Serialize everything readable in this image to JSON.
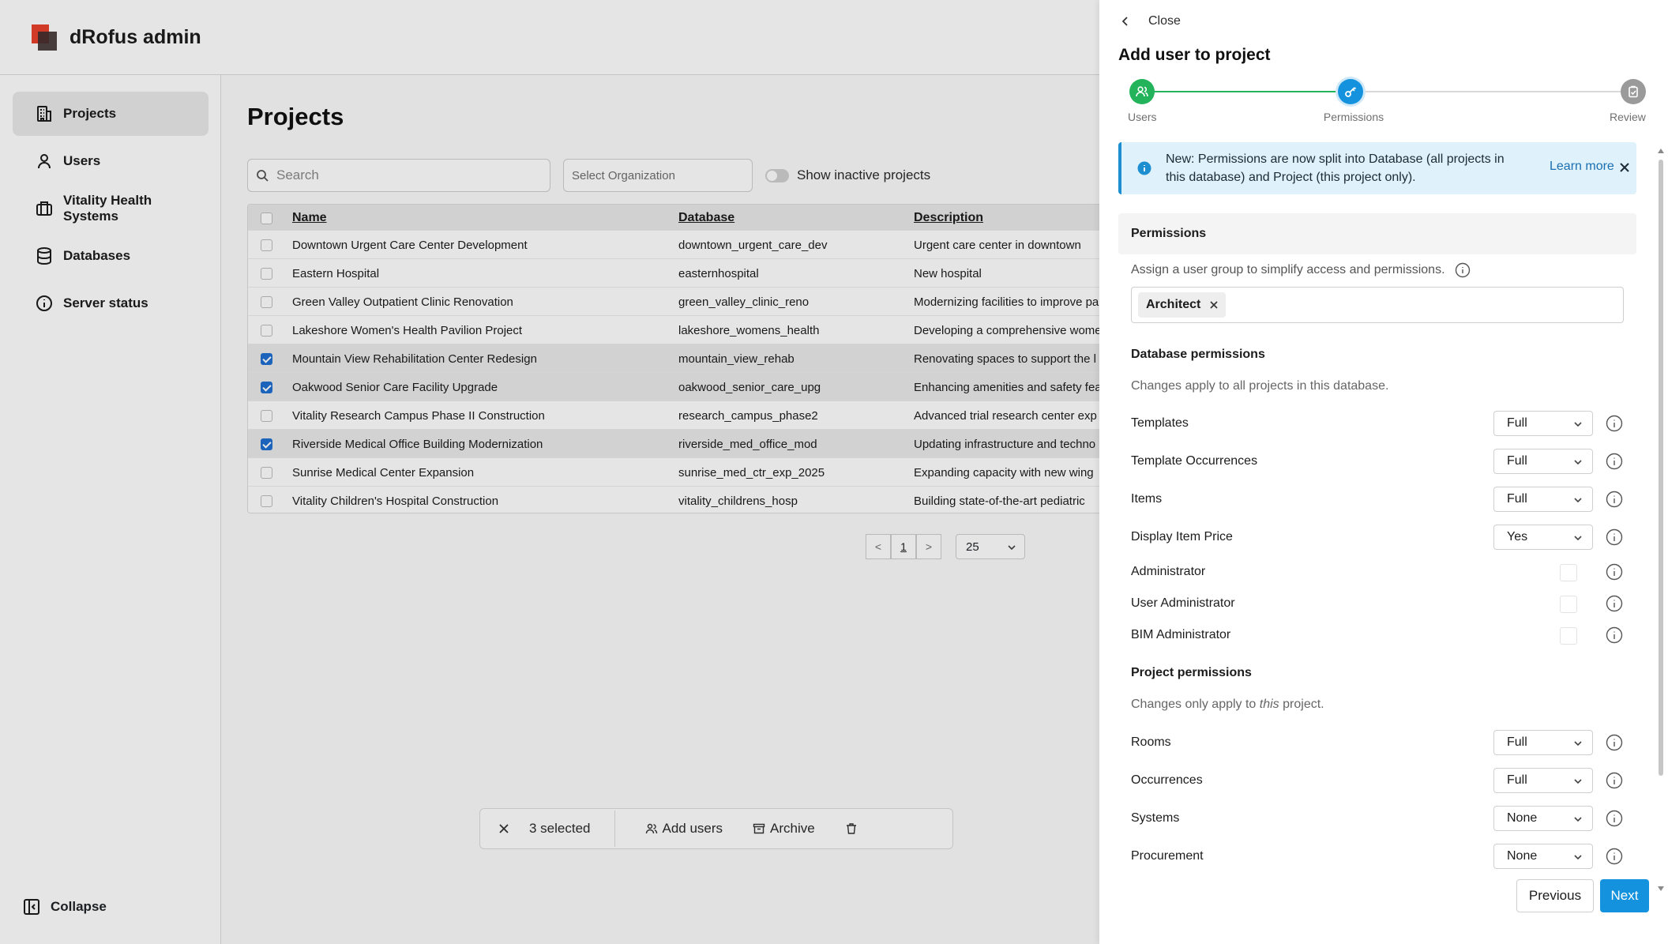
{
  "app": {
    "title": "dRofus admin"
  },
  "sidebar": {
    "items": [
      {
        "label": "Projects",
        "icon": "building-icon",
        "active": true
      },
      {
        "label": "Users",
        "icon": "user-icon"
      },
      {
        "label": "Vitality Health Systems",
        "icon": "briefcase-icon"
      },
      {
        "label": "Databases",
        "icon": "database-icon"
      },
      {
        "label": "Server status",
        "icon": "info-icon"
      }
    ],
    "collapse_label": "Collapse"
  },
  "projects": {
    "title": "Projects",
    "search_placeholder": "Search",
    "org_placeholder": "Select Organization",
    "inactive_toggle_label": "Show inactive projects",
    "columns": [
      "Name",
      "Database",
      "Description"
    ],
    "rows": [
      {
        "name": "Downtown Urgent Care Center Development",
        "database": "downtown_urgent_care_dev",
        "description": "Urgent care center in downtown",
        "selected": false
      },
      {
        "name": "Eastern Hospital",
        "database": "easternhospital",
        "description": "New hospital",
        "selected": false
      },
      {
        "name": "Green Valley Outpatient Clinic Renovation",
        "database": "green_valley_clinic_reno",
        "description": "Modernizing facilities to improve pa",
        "selected": false
      },
      {
        "name": "Lakeshore Women's Health Pavilion Project",
        "database": "lakeshore_womens_health",
        "description": "Developing a comprehensive wome",
        "selected": false
      },
      {
        "name": "Mountain View Rehabilitation Center Redesign",
        "database": "mountain_view_rehab",
        "description": "Renovating spaces to support the l",
        "selected": true
      },
      {
        "name": "Oakwood Senior Care Facility Upgrade",
        "database": "oakwood_senior_care_upg",
        "description": "Enhancing amenities and safety fea",
        "selected": true
      },
      {
        "name": "Vitality Research Campus Phase II Construction",
        "database": "research_campus_phase2",
        "description": "Advanced trial research center exp",
        "selected": false
      },
      {
        "name": "Riverside Medical Office Building Modernization",
        "database": "riverside_med_office_mod",
        "description": "Updating infrastructure and techno",
        "selected": true
      },
      {
        "name": "Sunrise Medical Center Expansion",
        "database": "sunrise_med_ctr_exp_2025",
        "description": "Expanding capacity with new wing",
        "selected": false
      },
      {
        "name": "Vitality Children's Hospital Construction",
        "database": "vitality_childrens_hosp",
        "description": "Building state-of-the-art pediatric",
        "selected": false
      }
    ],
    "pager": {
      "prev": "<",
      "current": "1",
      "next": ">",
      "page_size": "25"
    }
  },
  "action_bar": {
    "selected_text": "3 selected",
    "add_users": "Add users",
    "archive": "Archive"
  },
  "drawer": {
    "close_label": "Close",
    "title": "Add user to project",
    "steps": [
      {
        "label": "Users",
        "state": "done"
      },
      {
        "label": "Permissions",
        "state": "current"
      },
      {
        "label": "Review",
        "state": "pending"
      }
    ],
    "banner": {
      "text": "New: Permissions are now split into Database (all projects in this database) and Project (this project only).",
      "link": "Learn more"
    },
    "permissions_header": "Permissions",
    "group_hint": "Assign a user group to simplify access and permissions.",
    "group_tag": "Architect",
    "database_permissions": {
      "title": "Database permissions",
      "note": "Changes apply to all projects in this database.",
      "items": [
        {
          "label": "Templates",
          "type": "select",
          "value": "Full"
        },
        {
          "label": "Template Occurrences",
          "type": "select",
          "value": "Full"
        },
        {
          "label": "Items",
          "type": "select",
          "value": "Full"
        },
        {
          "label": "Display Item Price",
          "type": "select",
          "value": "Yes"
        },
        {
          "label": "Administrator",
          "type": "checkbox",
          "checked": false
        },
        {
          "label": "User Administrator",
          "type": "checkbox",
          "checked": false
        },
        {
          "label": "BIM Administrator",
          "type": "checkbox",
          "checked": false
        }
      ]
    },
    "project_permissions": {
      "title": "Project permissions",
      "note_before": "Changes only apply to ",
      "note_em": "this",
      "note_after": " project.",
      "items": [
        {
          "label": "Rooms",
          "type": "select",
          "value": "Full"
        },
        {
          "label": "Occurrences",
          "type": "select",
          "value": "Full"
        },
        {
          "label": "Systems",
          "type": "select",
          "value": "None"
        },
        {
          "label": "Procurement",
          "type": "select",
          "value": "None"
        }
      ]
    },
    "buttons": {
      "previous": "Previous",
      "next": "Next"
    }
  },
  "colors": {
    "accent": "#1592dd",
    "step_done": "#22b35b",
    "selected_checkbox": "#1f6fd1",
    "banner_bg": "#dff1fb"
  }
}
